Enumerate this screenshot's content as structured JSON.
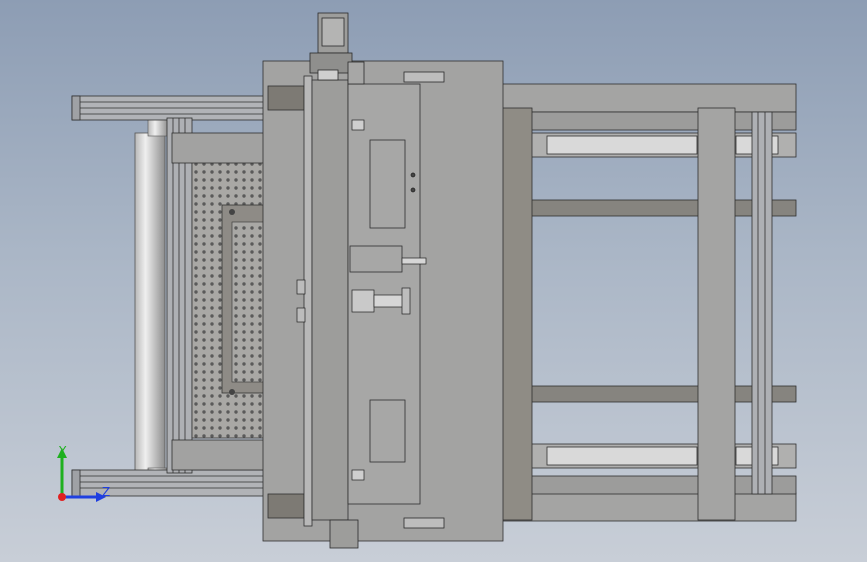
{
  "viewport": {
    "background_top": "#8d9db4",
    "background_bottom": "#c8ced7",
    "model_fill": "#9a9a98",
    "model_edge": "#2d2d2d",
    "plate_fill": "#8f8c85",
    "highlight_fill": "#d9d9d9"
  },
  "triad": {
    "y_label": "Y",
    "z_label": "Z",
    "y_color": "#1fb01f",
    "z_color": "#1f3fe0",
    "x_color": "#e02020"
  }
}
